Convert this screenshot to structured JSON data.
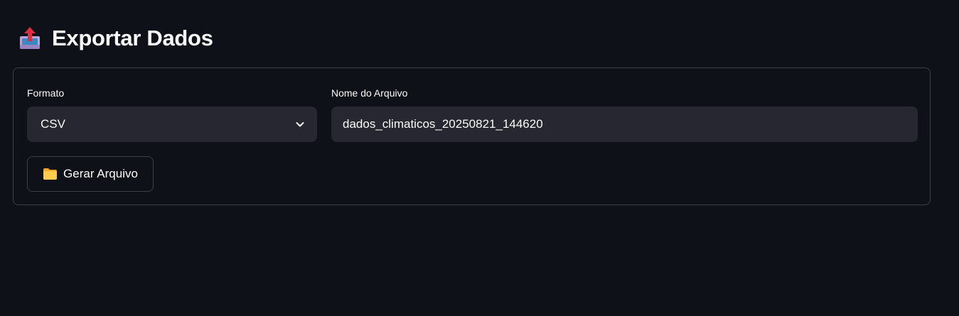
{
  "header": {
    "title": "Exportar Dados",
    "icon": "outbox-tray-icon"
  },
  "form": {
    "format": {
      "label": "Formato",
      "selected": "CSV",
      "icon": "chevron-down-icon"
    },
    "filename": {
      "label": "Nome do Arquivo",
      "value": "dados_climaticos_20250821_144620"
    },
    "generate_button": {
      "label": "Gerar Arquivo",
      "icon": "folder-icon"
    }
  },
  "colors": {
    "background": "#0e1117",
    "input_background": "#262730",
    "text": "#fafafa",
    "border": "rgba(250,250,250,0.2)"
  }
}
